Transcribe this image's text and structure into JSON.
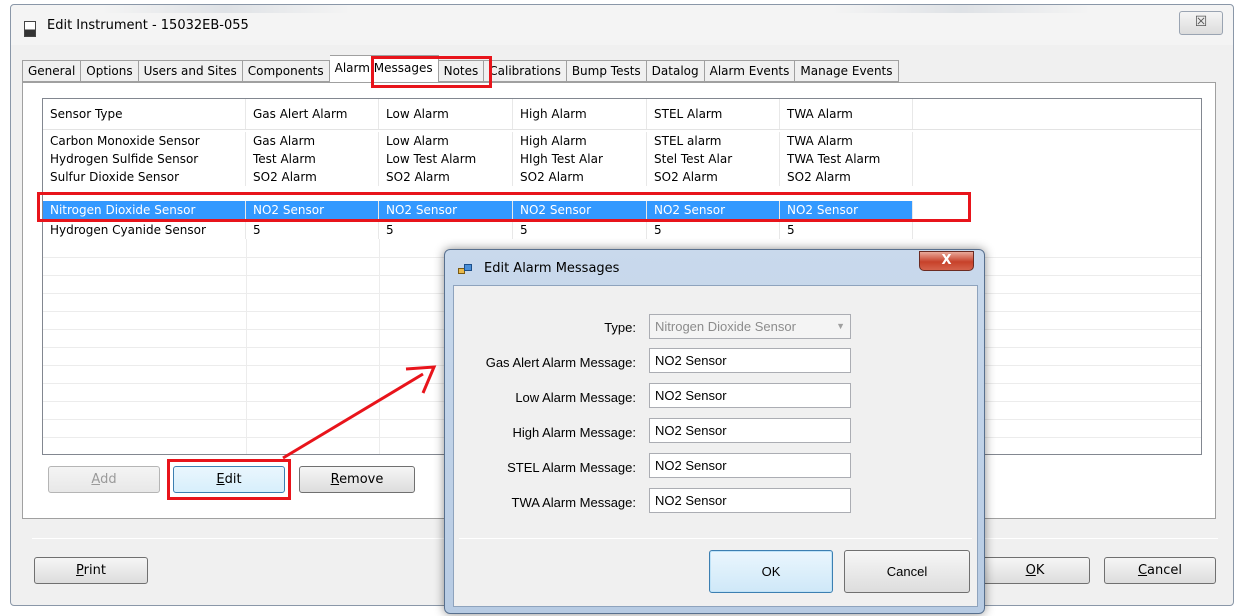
{
  "window": {
    "title": "Edit Instrument - 15032EB-055",
    "close_glyph": "☒"
  },
  "tabs": [
    {
      "label": "General"
    },
    {
      "label": "Options"
    },
    {
      "label": "Users and Sites"
    },
    {
      "label": "Components"
    },
    {
      "label": "Alarm Messages",
      "active": true
    },
    {
      "label": "Notes"
    },
    {
      "label": "Calibrations"
    },
    {
      "label": "Bump Tests"
    },
    {
      "label": "Datalog"
    },
    {
      "label": "Alarm Events"
    },
    {
      "label": "Manage Events"
    }
  ],
  "grid": {
    "columns": [
      "Sensor Type",
      "Gas Alert Alarm",
      "Low Alarm",
      "High Alarm",
      "STEL Alarm",
      "TWA Alarm",
      ""
    ],
    "rows": [
      [
        "Carbon Monoxide Sensor",
        "Gas Alarm",
        "Low Alarm",
        "High Alarm",
        "STEL alarm",
        "TWA Alarm"
      ],
      [
        "Hydrogen Sulfide Sensor",
        "Test Alarm",
        "Low Test Alarm",
        "HIgh Test Alar",
        "Stel Test Alar",
        "TWA Test Alarm"
      ],
      [
        "Sulfur Dioxide Sensor",
        "SO2 Alarm",
        "SO2 Alarm",
        "SO2 Alarm",
        "SO2 Alarm",
        "SO2 Alarm"
      ],
      [
        "Nitrogen Dioxide Sensor",
        "NO2 Sensor",
        "NO2 Sensor",
        "NO2 Sensor",
        "NO2 Sensor",
        "NO2 Sensor"
      ],
      [
        "Hydrogen Cyanide Sensor",
        "5",
        "5",
        "5",
        "5",
        "5"
      ]
    ],
    "selected_row": 3
  },
  "buttons": {
    "add": {
      "mnemonic": "A",
      "rest": "dd"
    },
    "edit": {
      "mnemonic": "E",
      "rest": "dit"
    },
    "remove": {
      "mnemonic": "R",
      "rest": "emove"
    },
    "print": {
      "mnemonic": "P",
      "rest": "rint"
    },
    "ok": {
      "mnemonic": "O",
      "rest": "K"
    },
    "cancel": {
      "mnemonic": "C",
      "rest": "ancel"
    }
  },
  "dialog": {
    "title": "Edit Alarm Messages",
    "close_glyph": "X",
    "fields": [
      {
        "label": "Type:",
        "value": "Nitrogen Dioxide Sensor",
        "disabled": true
      },
      {
        "label": "Gas Alert Alarm Message:",
        "value": "NO2 Sensor"
      },
      {
        "label": "Low Alarm Message:",
        "value": "NO2 Sensor"
      },
      {
        "label": "High Alarm Message:",
        "value": "NO2 Sensor"
      },
      {
        "label": "STEL Alarm Message:",
        "value": "NO2 Sensor"
      },
      {
        "label": "TWA Alarm Message:",
        "value": "NO2 Sensor"
      }
    ],
    "ok_label": "OK",
    "cancel_label": "Cancel"
  },
  "colors": {
    "annotation": "#e8141b",
    "selection": "#3399ff"
  },
  "icons": {
    "window": "document-icon",
    "dialog": "form-icon",
    "dropdown": "chevron-down-icon"
  }
}
